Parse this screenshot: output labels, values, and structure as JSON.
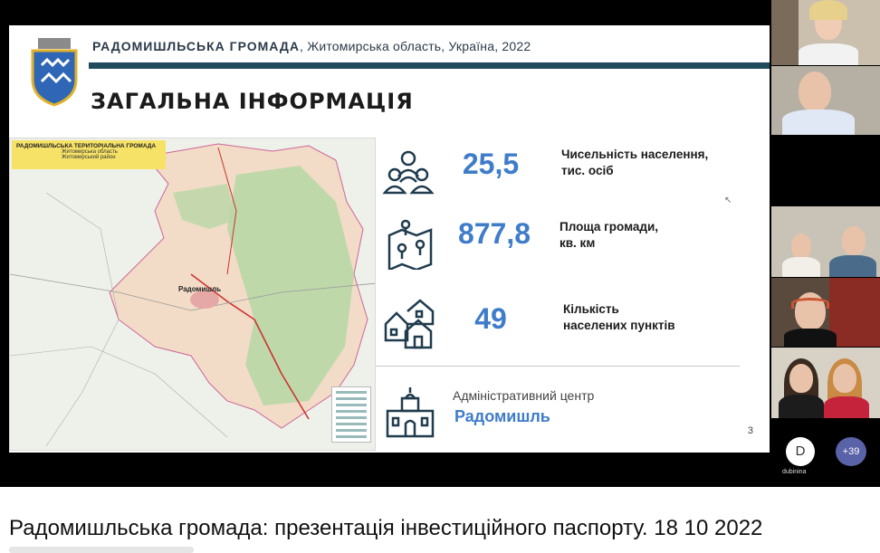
{
  "slide": {
    "header_bold": "РАДОМИШЛЬСЬКА  ГРОМАДА",
    "header_rest": ", Житомирська область, Україна, 2022",
    "title": "ЗАГАЛЬНА ІНФОРМАЦІЯ",
    "map": {
      "legend_title": "РАДОМИШЛЬСЬКА ТЕРИТОРІАЛЬНА ГРОМАДА",
      "legend_line2": "Житомирська область",
      "legend_line3": "Житомирський район",
      "main_town": "Радомишль"
    },
    "stats": [
      {
        "value": "25,5",
        "label_line1": "Чисельність населення,",
        "label_line2": "тис. осіб",
        "icon": "people-group-icon"
      },
      {
        "value": "877,8",
        "label_line1": "Площа громади,",
        "label_line2": "кв. км",
        "icon": "map-pins-icon"
      },
      {
        "value": "49",
        "label_line1": "Кількість",
        "label_line2": "населених пунктів",
        "icon": "houses-icon"
      }
    ],
    "admin_center_label": "Адміністративний центр",
    "admin_center_value": "Радомишль",
    "page_number": "3"
  },
  "participants": {
    "avatar_letter": "D",
    "username": "dubinina",
    "more_count": "+39"
  },
  "video_title": "Радомишльська громада: презентація інвестиційного паспорту. 18 10 2022",
  "colors": {
    "accent_blue": "#3f7cc9",
    "header_bar": "#1f4b5c",
    "legend_yellow": "#f6e267",
    "more_badge": "#5a62a8"
  }
}
